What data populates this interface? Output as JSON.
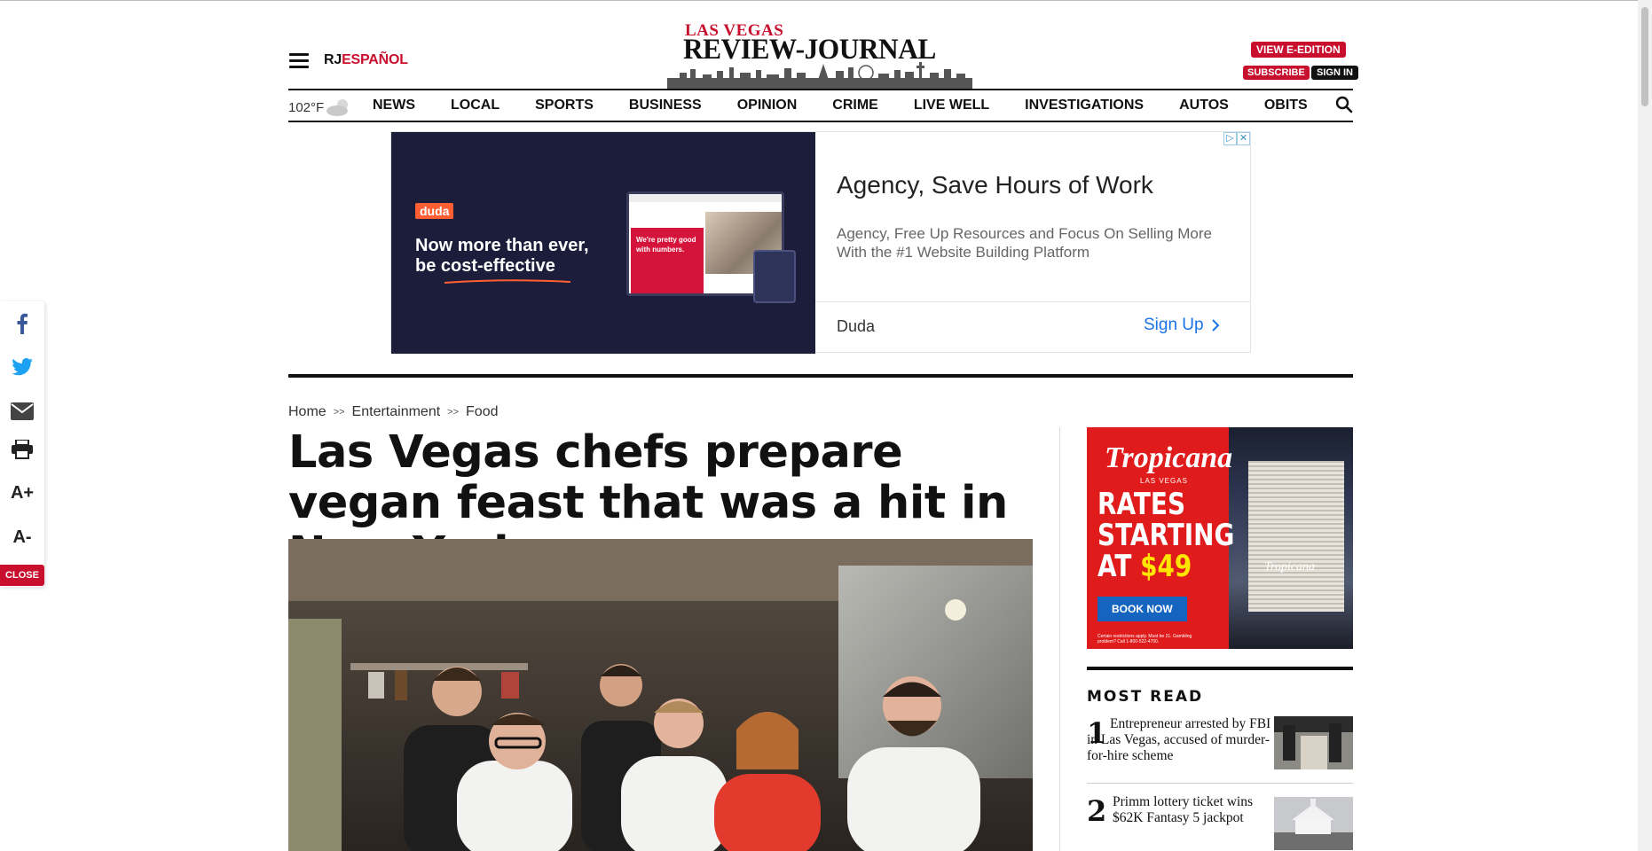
{
  "header": {
    "rj_label": "RJ",
    "espanol_label": "ESPAÑOL",
    "logo_top": "LAS VEGAS",
    "logo_name": "REVIEW-JOURNAL",
    "eedition_label": "VIEW E-EDITION",
    "subscribe_label": "SUBSCRIBE",
    "signin_label": "SIGN IN"
  },
  "weather": {
    "temp": "102°F"
  },
  "nav": [
    "NEWS",
    "LOCAL",
    "SPORTS",
    "BUSINESS",
    "OPINION",
    "CRIME",
    "LIVE WELL",
    "INVESTIGATIONS",
    "AUTOS",
    "OBITS"
  ],
  "ad": {
    "badge": "duda",
    "headline_1": "Now more than ever,",
    "headline_2": "be cost-effective",
    "mock_text": "We're pretty good with numbers.",
    "title": "Agency, Save Hours of Work",
    "desc": "Agency, Free Up Resources and Focus On Selling More With the #1 Website Building Platform",
    "brand": "Duda",
    "cta": "Sign Up"
  },
  "share": {
    "aplus": "A+",
    "aminus": "A-",
    "close": "CLOSE"
  },
  "breadcrumb": [
    "Home",
    "Entertainment",
    "Food"
  ],
  "breadcrumb_sep": ">>",
  "article": {
    "headline": "Las Vegas chefs prepare vegan feast that was a hit in New York"
  },
  "sidebar_ad": {
    "brand": "Tropicana",
    "brand_sub": "LAS VEGAS",
    "rates_1": "RATES",
    "rates_2": "STARTING",
    "rates_3a": "AT ",
    "price": "$49",
    "book": "BOOK NOW",
    "fine": "Certain restrictions apply. Must be 21. Gambling problem? Call 1-800-522-4700.",
    "hotel_sign": "Tropicana"
  },
  "most_read": {
    "title": "MOST READ",
    "items": [
      {
        "num": "1",
        "text": "Entrepreneur arrested by FBI in Las Vegas, accused of murder-for-hire scheme"
      },
      {
        "num": "2",
        "text": "Primm lottery ticket wins $62K Fantasy 5 jackpot"
      }
    ]
  }
}
